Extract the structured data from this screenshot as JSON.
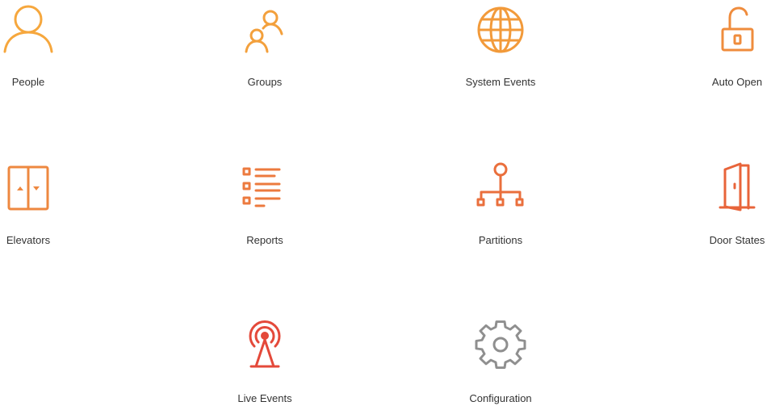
{
  "tiles": [
    {
      "label": "People",
      "icon": "person-icon",
      "color": "#f6a73d"
    },
    {
      "label": "Groups",
      "icon": "group-icon",
      "color": "#f3a03c"
    },
    {
      "label": "System Events",
      "icon": "globe-icon",
      "color": "#f29a3a"
    },
    {
      "label": "Auto Open",
      "icon": "unlocked-padlock-icon",
      "color": "#ef8c3d"
    },
    {
      "label": "Elevators",
      "icon": "elevator-icon",
      "color": "#ee8840"
    },
    {
      "label": "Reports",
      "icon": "list-icon",
      "color": "#ec7a3e"
    },
    {
      "label": "Partitions",
      "icon": "hierarchy-icon",
      "color": "#ea6f3c"
    },
    {
      "label": "Door States",
      "icon": "open-door-icon",
      "color": "#e8643a"
    },
    {
      "label": "Live Events",
      "icon": "broadcast-tower-icon",
      "color": "#e4493a"
    },
    {
      "label": "Configuration",
      "icon": "gear-icon",
      "color": "#8f8f8f"
    }
  ]
}
